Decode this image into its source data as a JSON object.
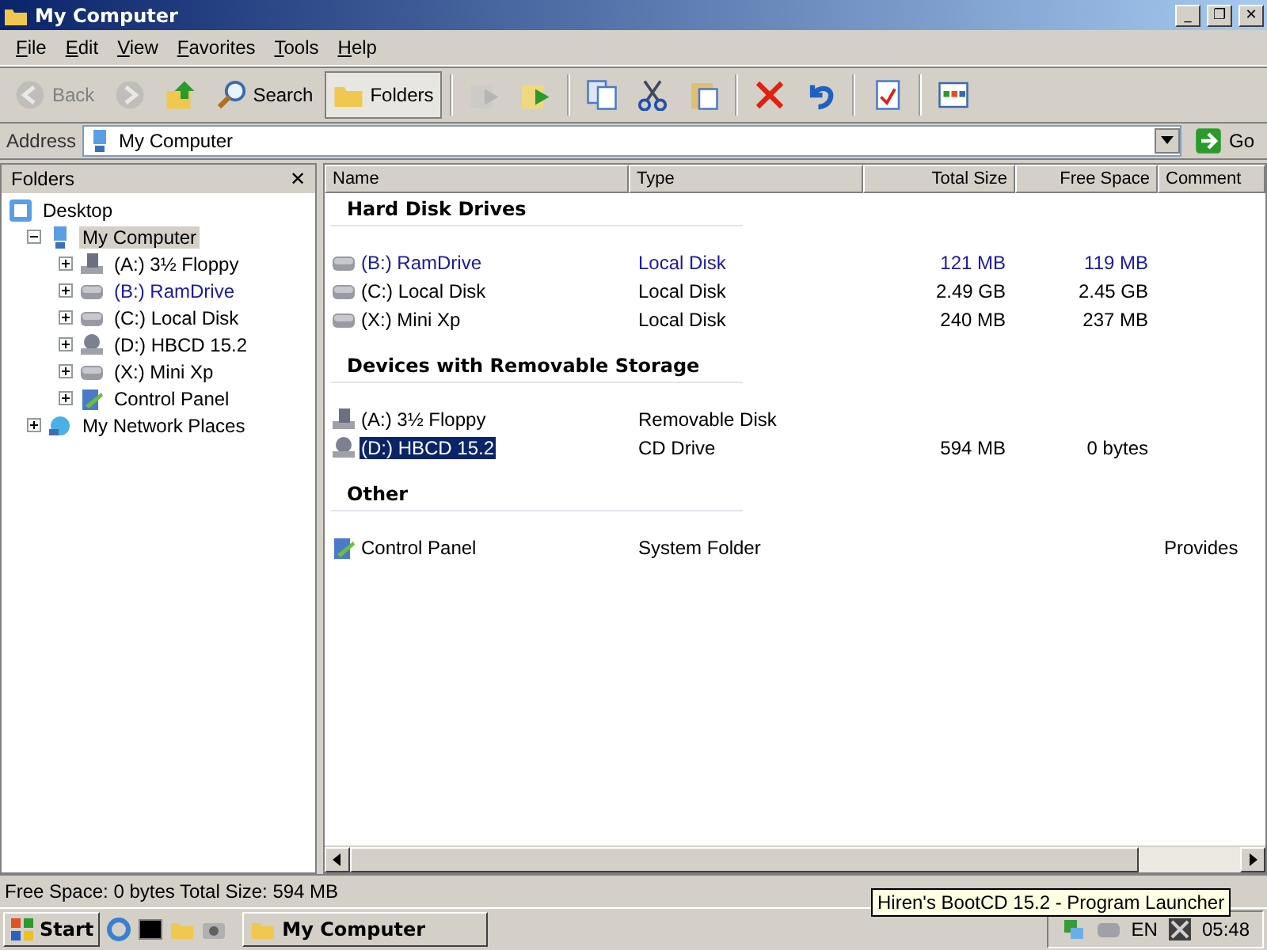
{
  "window": {
    "title": "My Computer",
    "controls": [
      "_",
      "❐",
      "✕"
    ]
  },
  "menu": [
    {
      "label": "File"
    },
    {
      "label": "Edit"
    },
    {
      "label": "View"
    },
    {
      "label": "Favorites"
    },
    {
      "label": "Tools"
    },
    {
      "label": "Help"
    }
  ],
  "toolbar": [
    {
      "kind": "back",
      "label": "Back",
      "disabled": true
    },
    {
      "kind": "forward",
      "disabled": true
    },
    {
      "kind": "up"
    },
    {
      "kind": "search",
      "label": "Search"
    },
    {
      "kind": "folders",
      "label": "Folders",
      "selected": true
    },
    {
      "kind": "sep"
    },
    {
      "kind": "moveto",
      "disabled": true
    },
    {
      "kind": "copyto"
    },
    {
      "kind": "sep"
    },
    {
      "kind": "copy"
    },
    {
      "kind": "cut"
    },
    {
      "kind": "paste"
    },
    {
      "kind": "sep"
    },
    {
      "kind": "delete"
    },
    {
      "kind": "undo"
    },
    {
      "kind": "sep"
    },
    {
      "kind": "properties"
    },
    {
      "kind": "sep"
    },
    {
      "kind": "views"
    }
  ],
  "address": {
    "label": "Address",
    "value": "My Computer",
    "go": "Go"
  },
  "folders": {
    "title": "Folders",
    "close": "✕",
    "tree": [
      {
        "label": "Desktop",
        "kind": "desktop",
        "selected": false,
        "compressed": false,
        "children": [
          {
            "label": "My Computer",
            "kind": "computer",
            "expanded": true,
            "selected": true,
            "compressed": false,
            "children": [
              {
                "label": "(A:) 3½ Floppy",
                "kind": "floppy",
                "expanded": false,
                "selected": false,
                "compressed": false
              },
              {
                "label": "(B:) RamDrive",
                "kind": "disk",
                "expanded": false,
                "selected": false,
                "compressed": true
              },
              {
                "label": "(C:) Local Disk",
                "kind": "disk",
                "expanded": false,
                "selected": false,
                "compressed": false
              },
              {
                "label": "(D:) HBCD 15.2",
                "kind": "cd",
                "expanded": false,
                "selected": false,
                "compressed": false
              },
              {
                "label": "(X:) Mini Xp",
                "kind": "disk",
                "expanded": false,
                "selected": false,
                "compressed": false
              },
              {
                "label": "Control Panel",
                "kind": "control",
                "expanded": false,
                "selected": false,
                "compressed": false
              }
            ]
          },
          {
            "label": "My Network Places",
            "kind": "network",
            "expanded": false,
            "selected": false,
            "compressed": false
          }
        ]
      }
    ]
  },
  "table": {
    "columns": [
      "Name",
      "Type",
      "Total Size",
      "Free Space",
      "Comment"
    ],
    "groups": [
      {
        "title": "Hard Disk Drives",
        "rows": [
          {
            "name": "(B:) RamDrive",
            "kind": "disk",
            "type": "Local Disk",
            "total": "121 MB",
            "free": "119 MB",
            "selected": false,
            "compressed": true
          },
          {
            "name": "(C:) Local Disk",
            "kind": "disk",
            "type": "Local Disk",
            "total": "2.49 GB",
            "free": "2.45 GB",
            "selected": false,
            "compressed": false
          },
          {
            "name": "(X:) Mini Xp",
            "kind": "disk",
            "type": "Local Disk",
            "total": "240 MB",
            "free": "237 MB",
            "selected": false,
            "compressed": false
          }
        ]
      },
      {
        "title": "Devices with Removable Storage",
        "rows": [
          {
            "name": "(A:) 3½ Floppy",
            "kind": "floppy",
            "type": "Removable Disk",
            "selected": false,
            "compressed": false
          },
          {
            "name": "(D:) HBCD 15.2",
            "kind": "cd",
            "type": "CD Drive",
            "total": "594 MB",
            "free": "0 bytes",
            "selected": true,
            "compressed": false
          }
        ]
      },
      {
        "title": "Other",
        "rows": [
          {
            "name": "Control Panel",
            "kind": "control",
            "type": "System Folder",
            "comment": "Provides",
            "selected": false,
            "compressed": false
          }
        ]
      }
    ]
  },
  "status_bar": {
    "text": "Free Space: 0 bytes Total Size: 594 MB"
  },
  "tooltip": "Hiren's BootCD 15.2 - Program Launcher",
  "taskbar": {
    "start": "Start",
    "tasks": [
      {
        "label": "My Computer",
        "selected": false
      }
    ],
    "tray": {
      "language": "EN",
      "clock": "05:48"
    }
  }
}
